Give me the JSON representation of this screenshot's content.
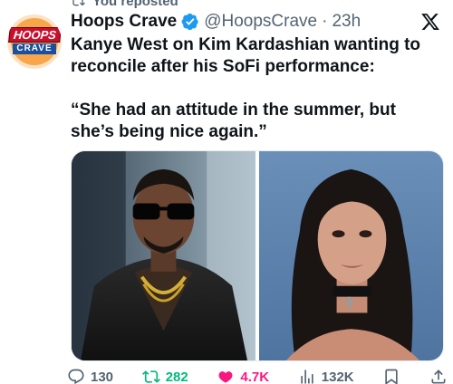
{
  "repost_banner": {
    "text": "You reposted"
  },
  "tweet": {
    "author_name": "Hoops Crave",
    "author_handle": "@HoopsCrave",
    "separator": "·",
    "time": "23h",
    "avatar": {
      "line1": "HOOPS",
      "line2": "CRAVE"
    },
    "body_headline": "Kanye West on Kim Kardashian wanting to reconcile after his SoFi performance:",
    "body_quote": "“She had an attitude in the summer, but she’s being nice again.”"
  },
  "media": [
    {
      "subject": "man in dark sunglasses and black leather jacket with gold chain"
    },
    {
      "subject": "woman with long dark hair and black choker against blue background"
    }
  ],
  "actions": {
    "replies": "130",
    "reposts": "282",
    "likes": "4.7K",
    "views": "132K"
  },
  "icons": {
    "repost": "repost-icon",
    "verified": "verified-badge-icon",
    "platform": "x-logo-icon",
    "reply": "reply-icon",
    "like": "heart-filled-icon",
    "views": "views-icon",
    "bookmark": "bookmark-icon",
    "share": "share-icon"
  },
  "colors": {
    "verified": "#1d9bf0",
    "repost_active": "#00ba7c",
    "like_active": "#f91880",
    "muted": "#536471"
  }
}
